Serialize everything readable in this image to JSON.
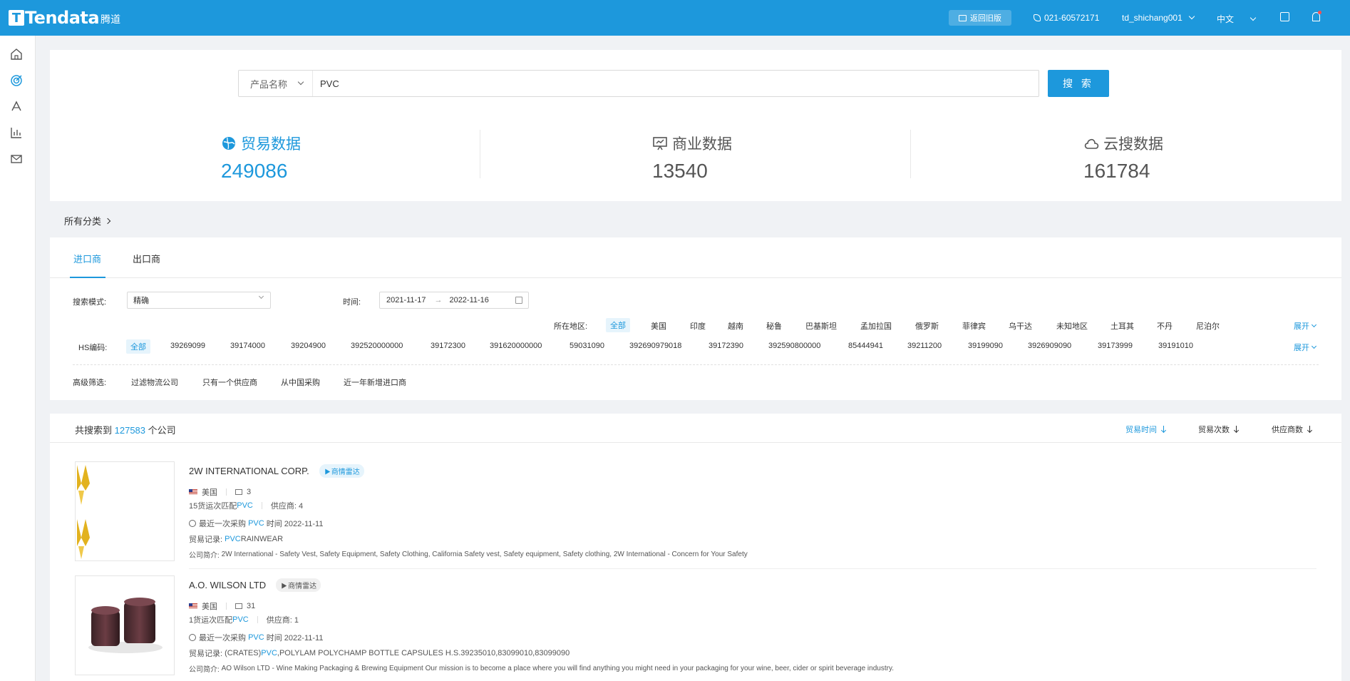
{
  "header": {
    "logo_text": "Tendata",
    "logo_cn": "腾道",
    "old_version_label": "返回旧版",
    "phone": "021-60572171",
    "username": "td_shichang001",
    "language": "中文"
  },
  "search": {
    "type_label": "产品名称",
    "query": "PVC",
    "button_label": "搜 索"
  },
  "stats": [
    {
      "label": "贸易数据",
      "value": "249086"
    },
    {
      "label": "商业数据",
      "value": "13540"
    },
    {
      "label": "云搜数据",
      "value": "161784"
    }
  ],
  "all_categories": "所有分类",
  "tabs": [
    {
      "label": "进口商"
    },
    {
      "label": "出口商"
    }
  ],
  "filters": {
    "search_mode_label": "搜索模式:",
    "search_mode_value": "精确",
    "time_label": "时间:",
    "date_start": "2021-11-17",
    "date_end": "2022-11-16",
    "region_label": "所在地区:",
    "regions": [
      "全部",
      "美国",
      "印度",
      "越南",
      "秘鲁",
      "巴基斯坦",
      "孟加拉国",
      "俄罗斯",
      "菲律宾",
      "乌干达",
      "未知地区",
      "土耳其",
      "不丹",
      "尼泊尔"
    ],
    "hs_label": "HS编码:",
    "hs_codes": [
      "全部",
      "39269099",
      "39174000",
      "39204900",
      "392520000000",
      "39172300",
      "391620000000",
      "59031090",
      "392690979018",
      "39172390",
      "392590800000",
      "85444941",
      "39211200",
      "39199090",
      "3926909090",
      "39173999",
      "39191010"
    ],
    "expand_label": "展开",
    "advanced_label": "高级筛选:",
    "advanced_options": [
      "过滤物流公司",
      "只有一个供应商",
      "从中国采购",
      "近一年新增进口商"
    ]
  },
  "results": {
    "count_prefix": "共搜索到",
    "count": "127583",
    "count_suffix": "个公司",
    "sorts": [
      "贸易时间",
      "贸易次数",
      "供应商数"
    ],
    "companies": [
      {
        "name": "2W INTERNATIONAL CORP.",
        "badge": "商情雷达",
        "country": "美国",
        "emails": "3",
        "match_prefix": "15货运次匹配",
        "match_keyword": "PVC",
        "suppliers": "供应商: 4",
        "last_purchase_prefix": "最近一次采购",
        "last_purchase_keyword": "PVC",
        "last_purchase_suffix": "时间 2022-11-11",
        "trade_label": "贸易记录:",
        "trade_prefix": "",
        "trade_keyword": "PVC",
        "trade_rest": " RAINWEAR",
        "intro_label": "公司简介:",
        "intro": "2W International - Safety Vest, Safety Equipment, Safety Clothing, California Safety vest, Safety equipment, Safety clothing, 2W International - Concern for Your Safety"
      },
      {
        "name": "A.O. WILSON LTD",
        "badge": "商情雷达",
        "country": "美国",
        "emails": "31",
        "match_prefix": "1货运次匹配",
        "match_keyword": "PVC",
        "suppliers": "供应商: 1",
        "last_purchase_prefix": "最近一次采购",
        "last_purchase_keyword": "PVC",
        "last_purchase_suffix": "时间 2022-11-11",
        "trade_label": "贸易记录:",
        "trade_prefix": "(CRATES) ",
        "trade_keyword": "PVC",
        "trade_rest": ",POLYLAM POLYCHAMP BOTTLE CAPSULES H.S.39235010,83099010,83099090",
        "intro_label": "公司简介:",
        "intro": "AO Wilson LTD - Wine Making Packaging & Brewing Equipment Our mission is to become a place where you will find anything you might need in your packaging for your wine, beer, cider or spirit beverage industry."
      }
    ]
  }
}
